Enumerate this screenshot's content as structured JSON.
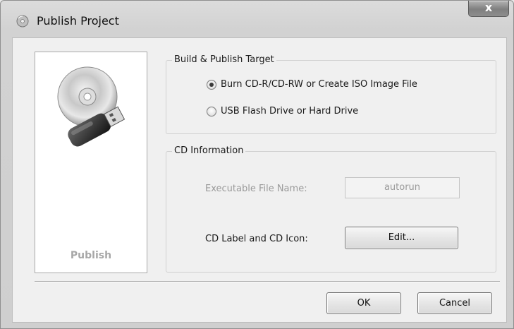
{
  "window": {
    "title": "Publish Project",
    "close_glyph": "x"
  },
  "side_panel": {
    "label": "Publish",
    "art_icon": "cd-usb-drive-icon"
  },
  "build_target": {
    "legend": "Build & Publish Target",
    "options": [
      {
        "label": "Burn CD-R/CD-RW or Create ISO Image File",
        "checked": true
      },
      {
        "label": "USB Flash Drive or Hard Drive",
        "checked": false
      }
    ]
  },
  "cd_info": {
    "legend": "CD Information",
    "exe_label": "Executable File Name:",
    "exe_value": "autorun",
    "label_icon_label": "CD Label and CD Icon:",
    "edit_button": "Edit..."
  },
  "footer": {
    "ok": "OK",
    "cancel": "Cancel"
  }
}
